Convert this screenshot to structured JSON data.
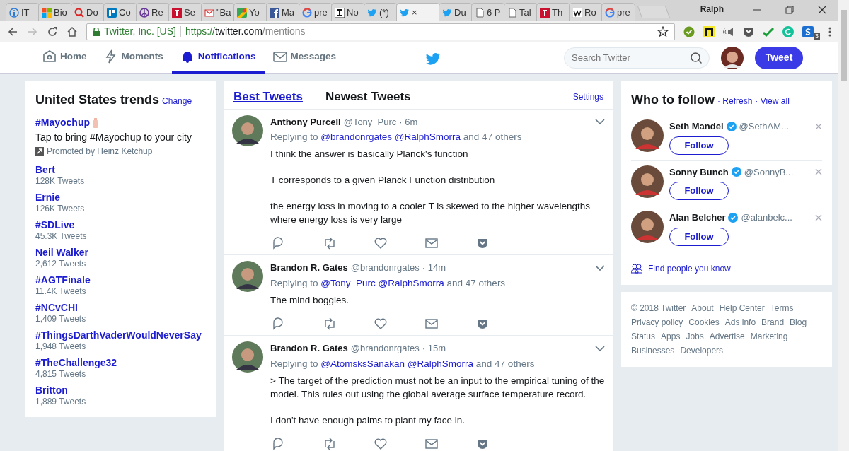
{
  "browser": {
    "tabs": [
      {
        "label": "IT",
        "selected": false
      },
      {
        "label": "Bio",
        "selected": false
      },
      {
        "label": "Do",
        "selected": false
      },
      {
        "label": "Co",
        "selected": false
      },
      {
        "label": "Re",
        "selected": false
      },
      {
        "label": "Se",
        "selected": false
      },
      {
        "label": "\"Ba",
        "selected": false
      },
      {
        "label": "Yo",
        "selected": false
      },
      {
        "label": "Ma",
        "selected": false
      },
      {
        "label": "pre",
        "selected": false
      },
      {
        "label": "No",
        "selected": false
      },
      {
        "label": "(*)",
        "selected": false
      },
      {
        "label": "×",
        "selected": true
      },
      {
        "label": "Du",
        "selected": false
      },
      {
        "label": "6 P",
        "selected": false
      },
      {
        "label": "Tal",
        "selected": false
      },
      {
        "label": "Th",
        "selected": false
      },
      {
        "label": "Ro",
        "selected": false
      },
      {
        "label": "pre",
        "selected": false
      }
    ],
    "profile": "Ralph",
    "security": "Twitter, Inc. [US]",
    "url_scheme": "https://",
    "url_host": "twitter.com",
    "url_path": "/mentions",
    "extension_badge": "3"
  },
  "nav": {
    "items": [
      {
        "label": "Home",
        "selected": false
      },
      {
        "label": "Moments",
        "selected": false
      },
      {
        "label": "Notifications",
        "selected": true
      },
      {
        "label": "Messages",
        "selected": false
      }
    ],
    "search": {
      "placeholder": "Search Twitter"
    },
    "tweet_button": "Tweet"
  },
  "trends": {
    "title": "United States trends",
    "change": "Change",
    "promoted": {
      "tag": "#Mayochup",
      "text": "Tap to bring #Mayochup to your city",
      "by": "Promoted by Heinz Ketchup"
    },
    "items": [
      {
        "name": "Bert",
        "count": "128K Tweets"
      },
      {
        "name": "Ernie",
        "count": "126K Tweets"
      },
      {
        "name": "#SDLive",
        "count": "45.3K Tweets"
      },
      {
        "name": "Neil Walker",
        "count": "2,612 Tweets"
      },
      {
        "name": "#AGTFinale",
        "count": "11.4K Tweets"
      },
      {
        "name": "#NCvCHI",
        "count": "1,409 Tweets"
      },
      {
        "name": "#ThingsDarthVaderWouldNeverSay",
        "count": "1,948 Tweets"
      },
      {
        "name": "#TheChallenge32",
        "count": "4,815 Tweets"
      },
      {
        "name": "Britton",
        "count": "1,889 Tweets"
      }
    ]
  },
  "timeline": {
    "tabs": [
      {
        "label": "Best Tweets",
        "selected": true
      },
      {
        "label": "Newest Tweets",
        "selected": false
      }
    ],
    "settings": "Settings",
    "tweets": [
      {
        "name": "Anthony Purcell",
        "handle": "@Tony_Purc",
        "time": "· 6m",
        "replying": "Replying to",
        "mentions": [
          "@brandonrgates",
          "@RalphSmorra"
        ],
        "others": "and 47 others",
        "paragraphs": [
          "I think the answer is basically Planck's function",
          "T corresponds to a given Planck Function distribution",
          "the energy loss in moving to a cooler T is skewed to the higher wavelengths where energy loss is very large"
        ]
      },
      {
        "name": "Brandon R. Gates",
        "handle": "@brandonrgates",
        "time": "· 14m",
        "replying": "Replying to",
        "mentions": [
          "@Tony_Purc",
          "@RalphSmorra"
        ],
        "others": "and 47 others",
        "paragraphs": [
          "The mind boggles."
        ]
      },
      {
        "name": "Brandon R. Gates",
        "handle": "@brandonrgates",
        "time": "· 15m",
        "replying": "Replying to",
        "mentions": [
          "@AtomsksSanakan",
          "@RalphSmorra"
        ],
        "others": "and 47 others",
        "paragraphs": [
          "> The target of the prediction must not be an input to the empirical tuning of the model. This rules out using the global average surface temperature record.",
          "I don't have enough palms to plant my face in."
        ]
      }
    ]
  },
  "who_to_follow": {
    "title": "Who to follow",
    "refresh": "· Refresh",
    "view_all": "· View all",
    "people": [
      {
        "name": "Seth Mandel",
        "handle": "@SethAM...",
        "verified": true,
        "button": "Follow"
      },
      {
        "name": "Sonny Bunch",
        "handle": "@SonnyB...",
        "verified": true,
        "button": "Follow"
      },
      {
        "name": "Alan Belcher",
        "handle": "@alanbelc...",
        "verified": true,
        "button": "Follow"
      }
    ],
    "find": "Find people you know"
  },
  "footer": {
    "links": [
      "© 2018 Twitter",
      "About",
      "Help Center",
      "Terms",
      "Privacy policy",
      "Cookies",
      "Ads info",
      "Brand",
      "Blog",
      "Status",
      "Apps",
      "Jobs",
      "Advertise",
      "Marketing",
      "Businesses",
      "Developers"
    ]
  }
}
